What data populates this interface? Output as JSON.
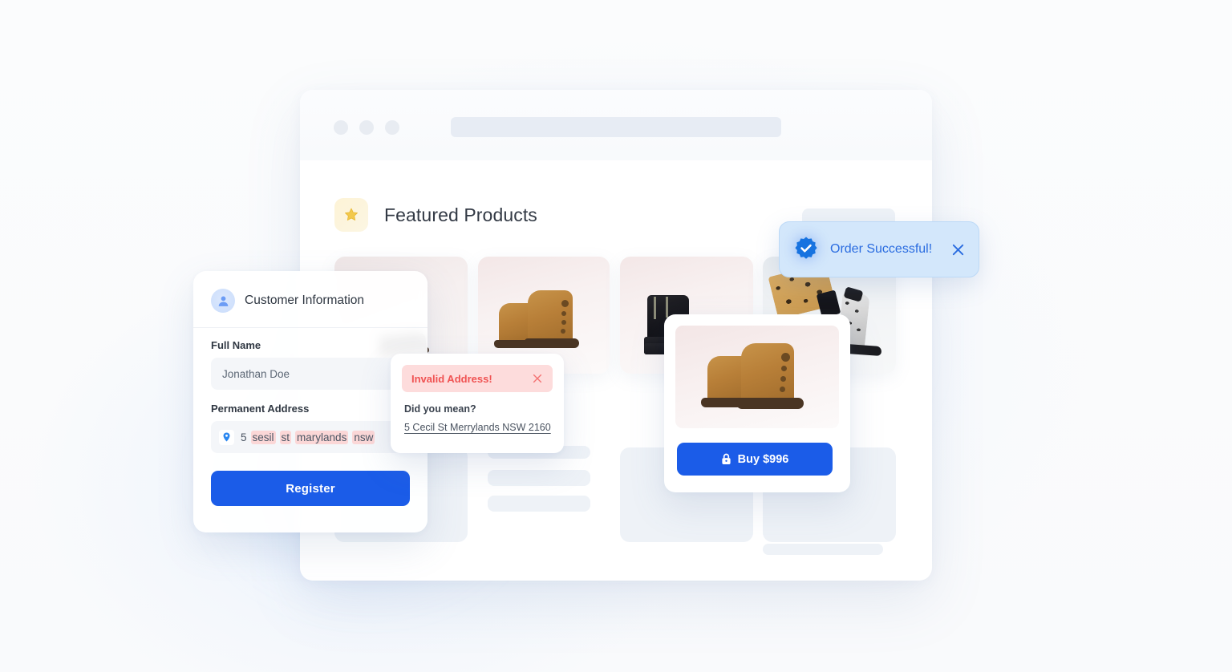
{
  "browser": {
    "traffic_lights": [
      "close-dot",
      "minimize-dot",
      "maximize-dot"
    ],
    "url_placeholder": ""
  },
  "featured": {
    "icon": "star-icon",
    "title": "Featured Products"
  },
  "products": [
    {
      "name": "product-card-1",
      "image": "dark-boot-thumbnail"
    },
    {
      "name": "product-card-2",
      "image": "tan-suede-ankle-boots"
    },
    {
      "name": "product-card-3",
      "image": "black-ankle-boot"
    },
    {
      "name": "product-card-4",
      "image": "leopard-bag-and-snakeskin-boot"
    }
  ],
  "customer_form": {
    "icon": "user-avatar-icon",
    "title": "Customer Information",
    "full_name": {
      "label": "Full Name",
      "value": "Jonathan Doe",
      "placeholder": "Full Name"
    },
    "permanent_address": {
      "label": "Permanent Address",
      "icon": "location-pin-icon",
      "placeholder": "Permanent Address",
      "value": "5 sesil st marylands nsw",
      "tokens": [
        {
          "text": "5",
          "error": false
        },
        {
          "text": "sesil",
          "error": true
        },
        {
          "text": "st",
          "error": true
        },
        {
          "text": "marylands",
          "error": true
        },
        {
          "text": "nsw",
          "error": true
        }
      ]
    },
    "submit_label": "Register"
  },
  "invalid_address_popover": {
    "banner_text": "Invalid Address!",
    "close_icon": "close-icon",
    "suggestion_label": "Did you mean?",
    "suggestion_value": "5 Cecil St Merrylands NSW 2160"
  },
  "buy_card": {
    "image": "tan-suede-ankle-boots",
    "lock_icon": "lock-icon",
    "button_label": "Buy $996",
    "price": "$996"
  },
  "toast": {
    "icon": "verified-check-badge-icon",
    "message": "Order Successful!",
    "close_icon": "close-icon"
  },
  "colors": {
    "primary_blue": "#1b5ce8",
    "toast_bg": "#d3e7fb",
    "toast_text": "#2a6ce0",
    "error_red": "#f05252",
    "error_bg": "#fddcdc",
    "token_highlight": "#fbd7d7",
    "star_yellow": "#f4cf55",
    "page_bg": "#fafbfc"
  }
}
